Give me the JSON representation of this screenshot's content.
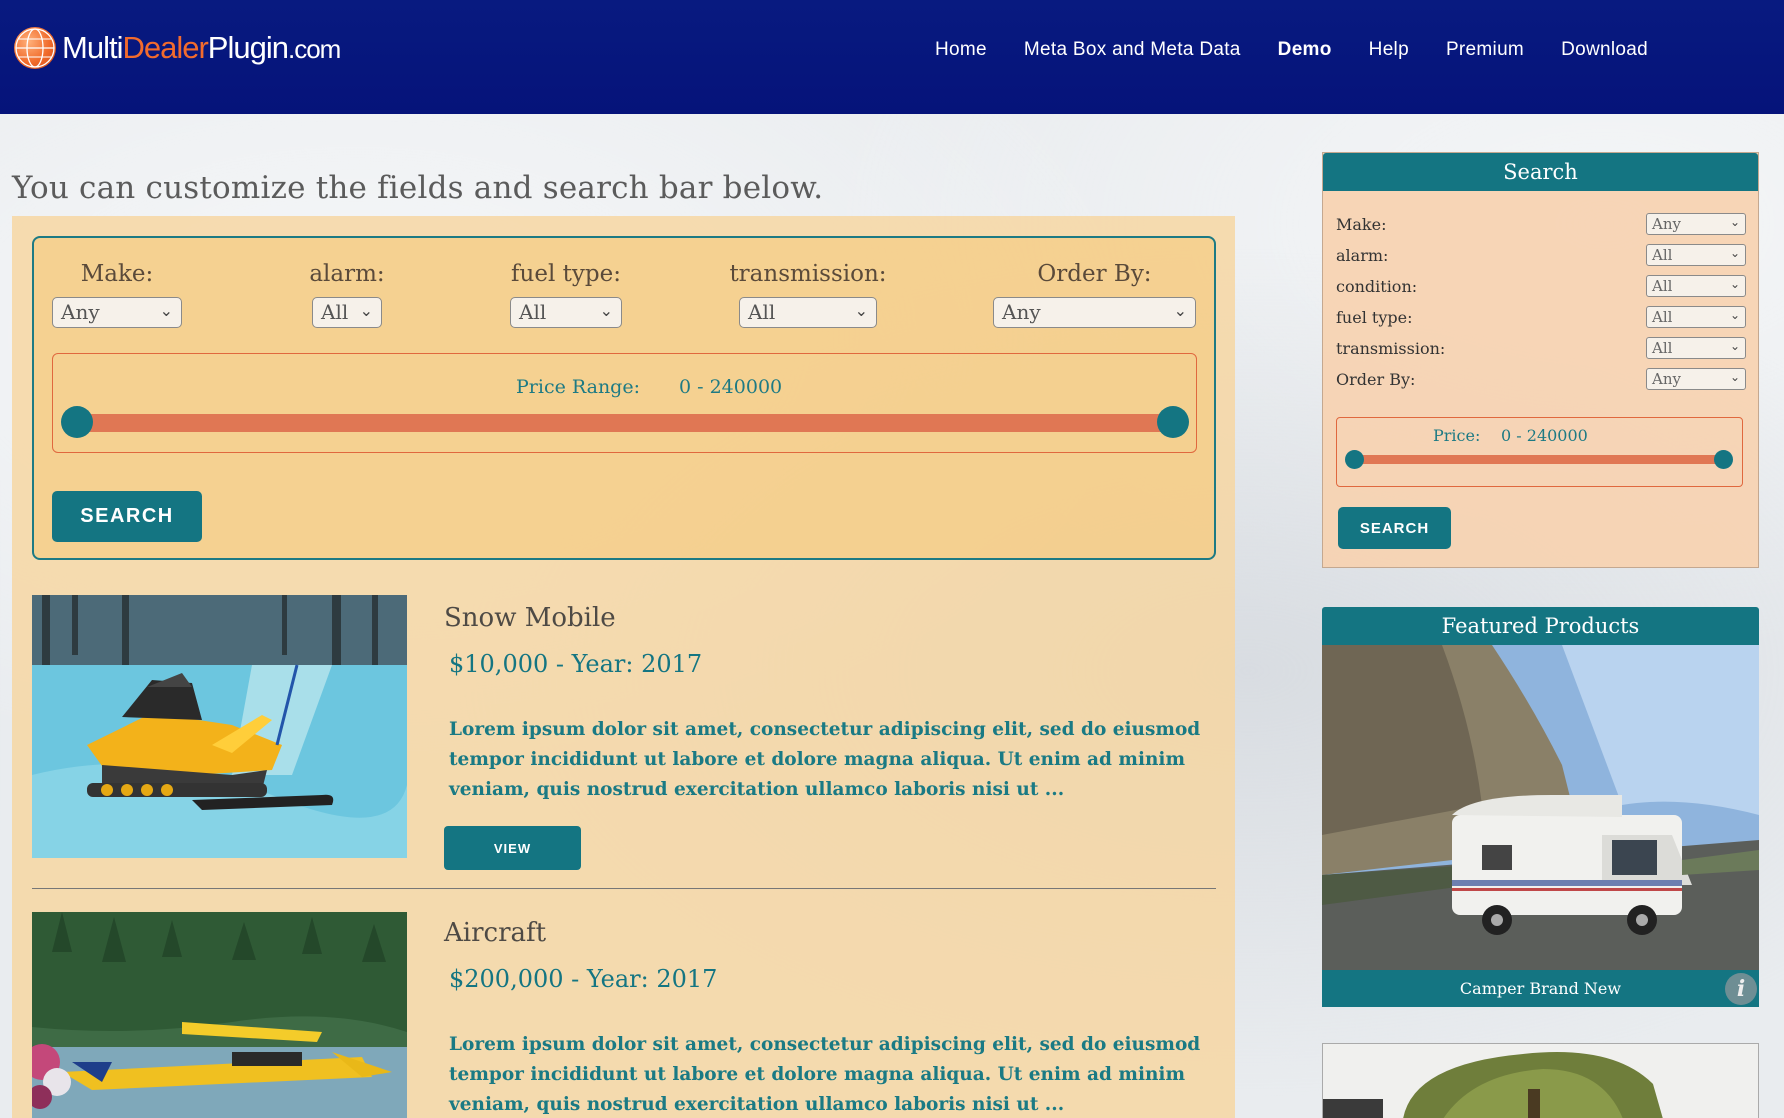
{
  "header": {
    "logo": {
      "multi": "Multi",
      "dealer": "Dealer",
      "plugin": "Plugin",
      "com": ".com"
    },
    "nav": [
      {
        "label": "Home",
        "active": false
      },
      {
        "label": "Meta Box and Meta Data",
        "active": false
      },
      {
        "label": "Demo",
        "active": true
      },
      {
        "label": "Help",
        "active": false
      },
      {
        "label": "Premium",
        "active": false
      },
      {
        "label": "Download",
        "active": false
      }
    ],
    "colors": {
      "bar": "#061578",
      "accent": "#f26b2d"
    }
  },
  "intro": "You can customize the fields and search bar below.",
  "search": {
    "fields": [
      {
        "label": "Make:",
        "value": "Any"
      },
      {
        "label": "alarm:",
        "value": "All"
      },
      {
        "label": "fuel type:",
        "value": "All"
      },
      {
        "label": "transmission:",
        "value": "All"
      },
      {
        "label": "Order By:",
        "value": "Any"
      }
    ],
    "price_label": "Price Range:",
    "price_value": "0 - 240000",
    "button": "SEARCH"
  },
  "listings": [
    {
      "title": "Snow Mobile",
      "price": "$10,000 - Year: 2017",
      "description": "Lorem ipsum dolor sit amet, consectetur adipiscing elit, sed do eiusmod tempor incididunt ut labore et dolore magna aliqua. Ut enim ad minim veniam, quis nostrud exercitation ullamco laboris nisi ut ...",
      "button": "VIEW"
    },
    {
      "title": "Aircraft",
      "price": "$200,000 - Year: 2017",
      "description": "Lorem ipsum dolor sit amet, consectetur adipiscing elit, sed do eiusmod tempor incididunt ut labore et dolore magna aliqua. Ut enim ad minim veniam, quis nostrud exercitation ullamco laboris nisi ut ..."
    }
  ],
  "sidebar": {
    "search": {
      "title": "Search",
      "rows": [
        {
          "label": "Make:",
          "value": "Any"
        },
        {
          "label": "alarm:",
          "value": "All"
        },
        {
          "label": "condition:",
          "value": "All"
        },
        {
          "label": "fuel type:",
          "value": "All"
        },
        {
          "label": "transmission:",
          "value": "All"
        },
        {
          "label": "Order By:",
          "value": "Any"
        }
      ],
      "price_label": "Price:",
      "price_value": "0 - 240000",
      "button": "SEARCH"
    },
    "featured": {
      "title": "Featured Products",
      "caption": "Camper Brand New",
      "info_icon": "i"
    }
  },
  "theme": {
    "teal": "#147582",
    "orange": "#e07754"
  }
}
